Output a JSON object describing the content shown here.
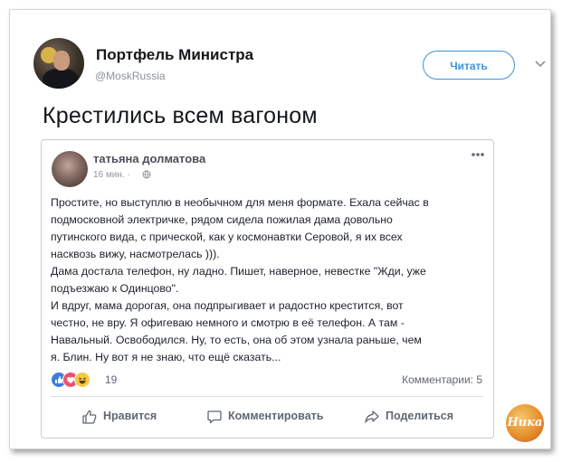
{
  "tweet": {
    "author_name": "Портфель Министра",
    "author_handle": "@MoskRussia",
    "follow_label": "Читать",
    "text": "Крестились всем вагоном"
  },
  "facebook_post": {
    "author_name": "татьяна долматова",
    "time": "16 мин. ·",
    "body_lines": [
      "Простите, но выступлю в необычном для меня формате. Ехала сейчас в",
      "подмосковной электричке, рядом сидела пожилая дама довольно",
      "путинского вида, с прической, как у космонавтки Серовой, я их всех",
      "насквозь вижу, насмотрелась ))).",
      "Дама достала телефон, ну ладно. Пишет, наверное, невестке \"Жди, уже",
      "подъезжаю к Одинцово\".",
      "И вдруг, мама дорогая, она подпрыгивает и радостно крестится, вот",
      "честно, не вру. Я офигеваю немного и смотрю в её телефон. А там -",
      "Навальный. Освободился. Ну, то есть, она об этом узнала раньше, чем",
      "я. Блин. Ну вот я не знаю, что ещё сказать..."
    ],
    "reactions_count": "19",
    "comments_count": "Комментарии: 5",
    "actions": {
      "like": "Нравится",
      "comment": "Комментировать",
      "share": "Поделиться"
    }
  },
  "watermark": {
    "text": "Ника"
  },
  "colors": {
    "twitter_blue": "#3b94d9",
    "facebook_gray": "#606770"
  }
}
